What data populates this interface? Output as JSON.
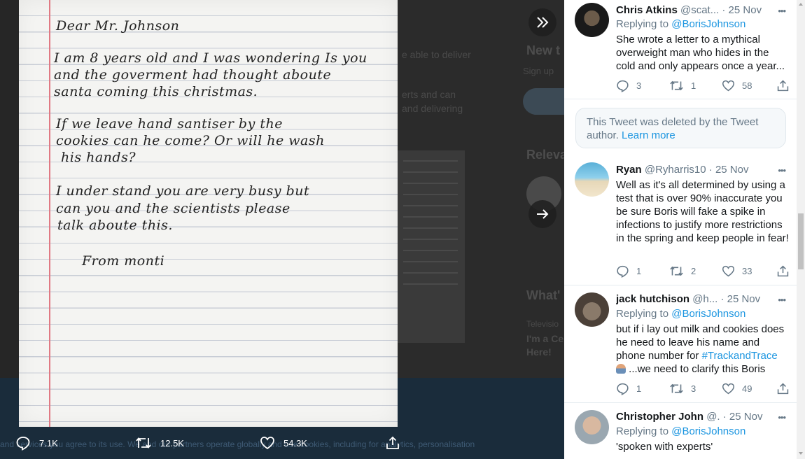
{
  "letter": {
    "greeting": "Dear Mr. Johnson",
    "lines": [
      "I am 8 years old and I was wondering Is you",
      "and the goverment had thought aboute",
      "santa coming this christmas.",
      "If we leave hand santiser by the",
      "cookies can he come? Or will he wash",
      "his hands?",
      "I under stand you are very busy but",
      "can you and the scientists please",
      "talk aboute this."
    ],
    "signoff": "From monti"
  },
  "background_page": {
    "line1": "e able to deliver",
    "heading1": "New t",
    "sub1": "Sign up",
    "line2": "erts and can",
    "line3": "and delivering",
    "heading2": "Releva",
    "heading3": "What'",
    "small1": "Televisio",
    "small2": "I'm a Ce",
    "small3": "Here!"
  },
  "cookie_notice": "and services you agree to its use. We and our partners operate globally and use cookies, including for analytics, personalisation",
  "media_actions": {
    "replies": "7.1K",
    "retweets": "12.5K",
    "likes": "54.3K"
  },
  "icons": {
    "collapse": "double-chevron-right-icon",
    "next": "arrow-right-icon",
    "reply": "reply-icon",
    "retweet": "retweet-icon",
    "like": "heart-icon",
    "share": "share-icon",
    "more": "more-dots-icon"
  },
  "replies": [
    {
      "name": "Chris Atkins",
      "handle": "@scat...",
      "date": "· 25 Nov",
      "replying_label": "Replying to",
      "replying_handle": "@BorisJohnson",
      "text": "She wrote a letter to a mythical overweight man who hides in the cold and only appears once a year...",
      "stats": {
        "replies": "3",
        "retweets": "1",
        "likes": "58"
      }
    },
    {
      "deleted_text": "This Tweet was deleted by the Tweet author.",
      "learn_more": "Learn more"
    },
    {
      "name": "Ryan",
      "handle": "@Ryharris10",
      "date": "· 25 Nov",
      "text": "Well as it's all determined by using a test that is over 90% inaccurate you be sure Boris will fake a spike in infections to justify more restrictions in the spring and keep people in fear!",
      "stats": {
        "replies": "1",
        "retweets": "2",
        "likes": "33"
      }
    },
    {
      "name": "jack hutchison",
      "handle": "@h...",
      "date": "· 25 Nov",
      "replying_label": "Replying to",
      "replying_handle": "@BorisJohnson",
      "text": "but if i lay out milk and cookies does he need to leave his name and phone number for",
      "hashtag": "#TrackandTrace",
      "text2": "...we need to clarify this Boris",
      "stats": {
        "replies": "1",
        "retweets": "3",
        "likes": "49"
      }
    },
    {
      "name": "Christopher John",
      "handle": "@.",
      "date": "· 25 Nov",
      "replying_label": "Replying to",
      "replying_handle": "@BorisJohnson",
      "text": "'spoken with experts'"
    }
  ],
  "colors": {
    "link": "#1b95e0",
    "muted": "#657786",
    "text": "#14171a"
  }
}
